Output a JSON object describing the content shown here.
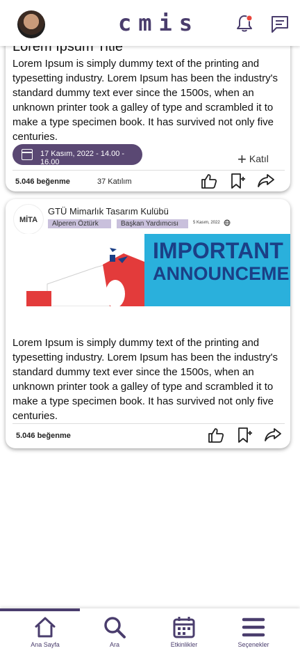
{
  "header": {
    "brand": "cmis",
    "icons": [
      "avatar",
      "bell-icon",
      "chat-icon"
    ]
  },
  "post1": {
    "title": "Lorem Ipsum Title",
    "body": "Lorem Ipsum is simply dummy text of the printing and typesetting industry. Lorem Ipsum has been the industry's standard dummy text ever since the 1500s, when an unknown printer took a galley of type and scrambled it to make a type specimen book. It has survived not only five centuries.",
    "event_date": "17 Kasım, 2022 - 14.00 - 16.00",
    "join_label": "Katıl",
    "likes": "5.046 beğenme",
    "participants": "37 Katılım"
  },
  "post2": {
    "org_logo_text": "MİTA",
    "org_name": "GTÜ Mimarlık Tasarım Kulübü",
    "author": "Alperen Öztürk",
    "role": "Başkan Yardımcısı",
    "date": "5 Kasım, 2022",
    "banner_line1": "IMPORTANT",
    "banner_line2": "ANNOUNCEMENT",
    "body": "Lorem Ipsum is simply dummy text of the printing and typesetting industry. Lorem Ipsum has been the industry's standard dummy text ever since the 1500s, when an unknown printer took a galley of type and scrambled it to make a type specimen book. It has survived not only five centuries.",
    "likes": "5.046 beğenme"
  },
  "bottom_nav": {
    "home": "Ana Sayfa",
    "search": "Ara",
    "events": "Etkinlikler",
    "options": "Seçenekler"
  },
  "colors": {
    "brand": "#4a3d6d",
    "pill": "#5a4873",
    "tag": "#c9c0dc",
    "bell_dot": "#e8463c"
  }
}
